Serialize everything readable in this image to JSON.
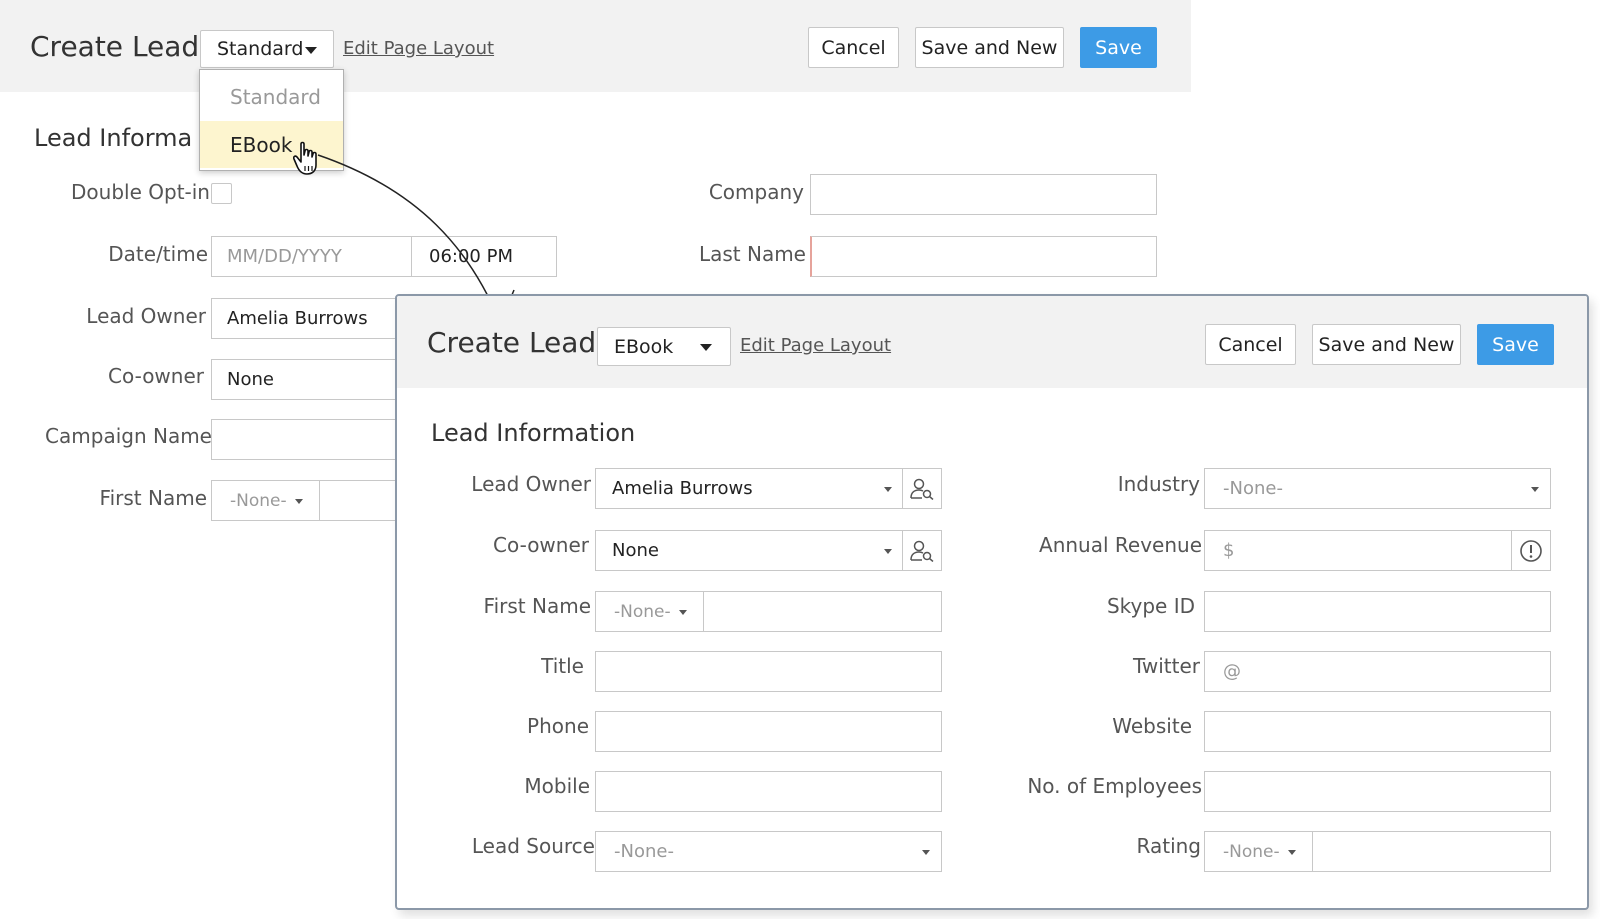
{
  "background": {
    "title": "Create Lead",
    "layout_select": "Standard",
    "edit_link": "Edit Page Layout",
    "cancel": "Cancel",
    "save_new": "Save and New",
    "save": "Save",
    "section": "Lead Informa",
    "dropdown": {
      "options": [
        "Standard",
        "EBook"
      ],
      "highlighted": "EBook"
    },
    "fields": {
      "double_optin": "Double Opt-in",
      "datetime": "Date/time",
      "date_placeholder": "MM/DD/YYYY",
      "time_value": "06:00 PM",
      "lead_owner": "Lead Owner",
      "lead_owner_value": "Amelia Burrows",
      "coowner": "Co-owner",
      "coowner_value": "None",
      "campaign": "Campaign Name",
      "first_name": "First Name",
      "salutation": "-None-",
      "company": "Company",
      "last_name": "Last Name"
    }
  },
  "modal": {
    "title": "Create Lead",
    "layout_select": "EBook",
    "edit_link": "Edit Page Layout",
    "cancel": "Cancel",
    "save_new": "Save and New",
    "save": "Save",
    "section": "Lead Information",
    "left": {
      "lead_owner": "Lead Owner",
      "lead_owner_value": "Amelia Burrows",
      "coowner": "Co-owner",
      "coowner_value": "None",
      "first_name": "First Name",
      "salutation": "-None-",
      "title": "Title",
      "phone": "Phone",
      "mobile": "Mobile",
      "lead_source": "Lead Source",
      "lead_source_value": "-None-"
    },
    "right": {
      "industry": "Industry",
      "industry_value": "-None-",
      "annual_revenue": "Annual Revenue",
      "currency": "$",
      "skype": "Skype ID",
      "twitter": "Twitter",
      "twitter_prefix": "@",
      "website": "Website",
      "employees": "No. of Employees",
      "rating": "Rating",
      "rating_value": "-None-"
    }
  },
  "colors": {
    "primary": "#3d9be6",
    "highlight": "#fdf5cf",
    "header_bg": "#f2f2f2"
  },
  "icons": [
    "caret-down-icon",
    "user-search-icon",
    "info-icon",
    "hand-pointer-icon",
    "arrow-connector"
  ]
}
